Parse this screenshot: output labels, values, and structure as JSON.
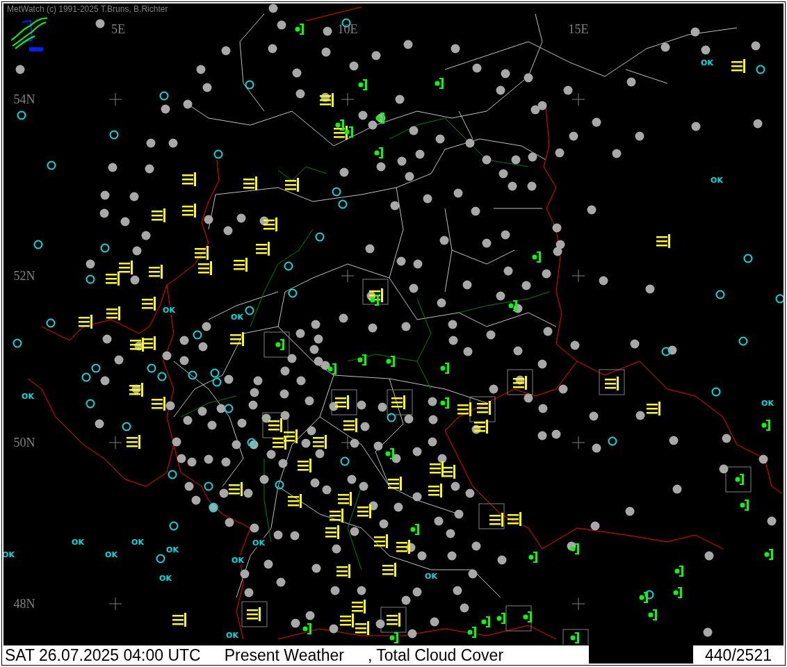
{
  "window": {
    "title": "MetWatch  (c) 1991-2025 T.Bruns, B.Richter"
  },
  "map": {
    "longitude_labels": [
      "5E",
      "10E",
      "15E"
    ],
    "latitude_labels": [
      "54N",
      "52N",
      "50N",
      "48N"
    ],
    "station_labels": [
      "OK",
      "OK",
      "OK",
      "OK",
      "OK",
      "OK",
      "OK",
      "OK",
      "OK",
      "OK",
      "OK",
      "OK",
      "OK",
      "OK",
      "OK",
      "OK"
    ]
  },
  "status_bar": {
    "datetime": "SAT 26.07.2025 04:00 UTC",
    "layer_1": "Present Weather",
    "layer_2": ", Total Cloud Cover",
    "count": "440/2521"
  }
}
